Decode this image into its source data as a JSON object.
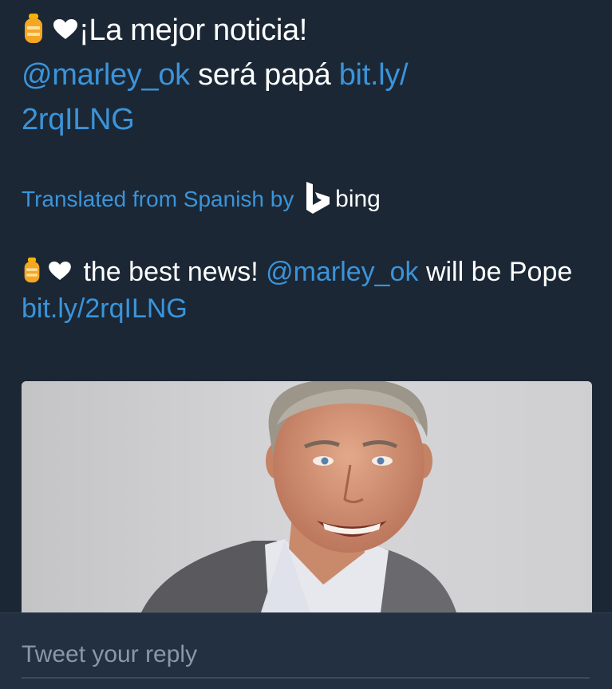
{
  "tweet": {
    "original": {
      "text": "¡La mejor noticia!",
      "mention": "@marley_ok",
      "mid": " será papá ",
      "link_part1": "bit.ly/",
      "link_part2": "2rqILNG"
    },
    "translated_by": {
      "label": "Translated from Spanish by",
      "service": "bing"
    },
    "translation": {
      "text": " the best news! ",
      "mention": "@marley_ok",
      "mid": " will be Pope ",
      "link": "bit.ly/2rqILNG"
    }
  },
  "reply": {
    "placeholder": "Tweet your reply"
  },
  "colors": {
    "background": "#1b2735",
    "link": "#3b94d9",
    "text": "#ffffff",
    "placeholder": "#8899a6"
  },
  "icons": [
    "baby-bottle-icon",
    "heart-icon",
    "bing-logo-icon"
  ]
}
